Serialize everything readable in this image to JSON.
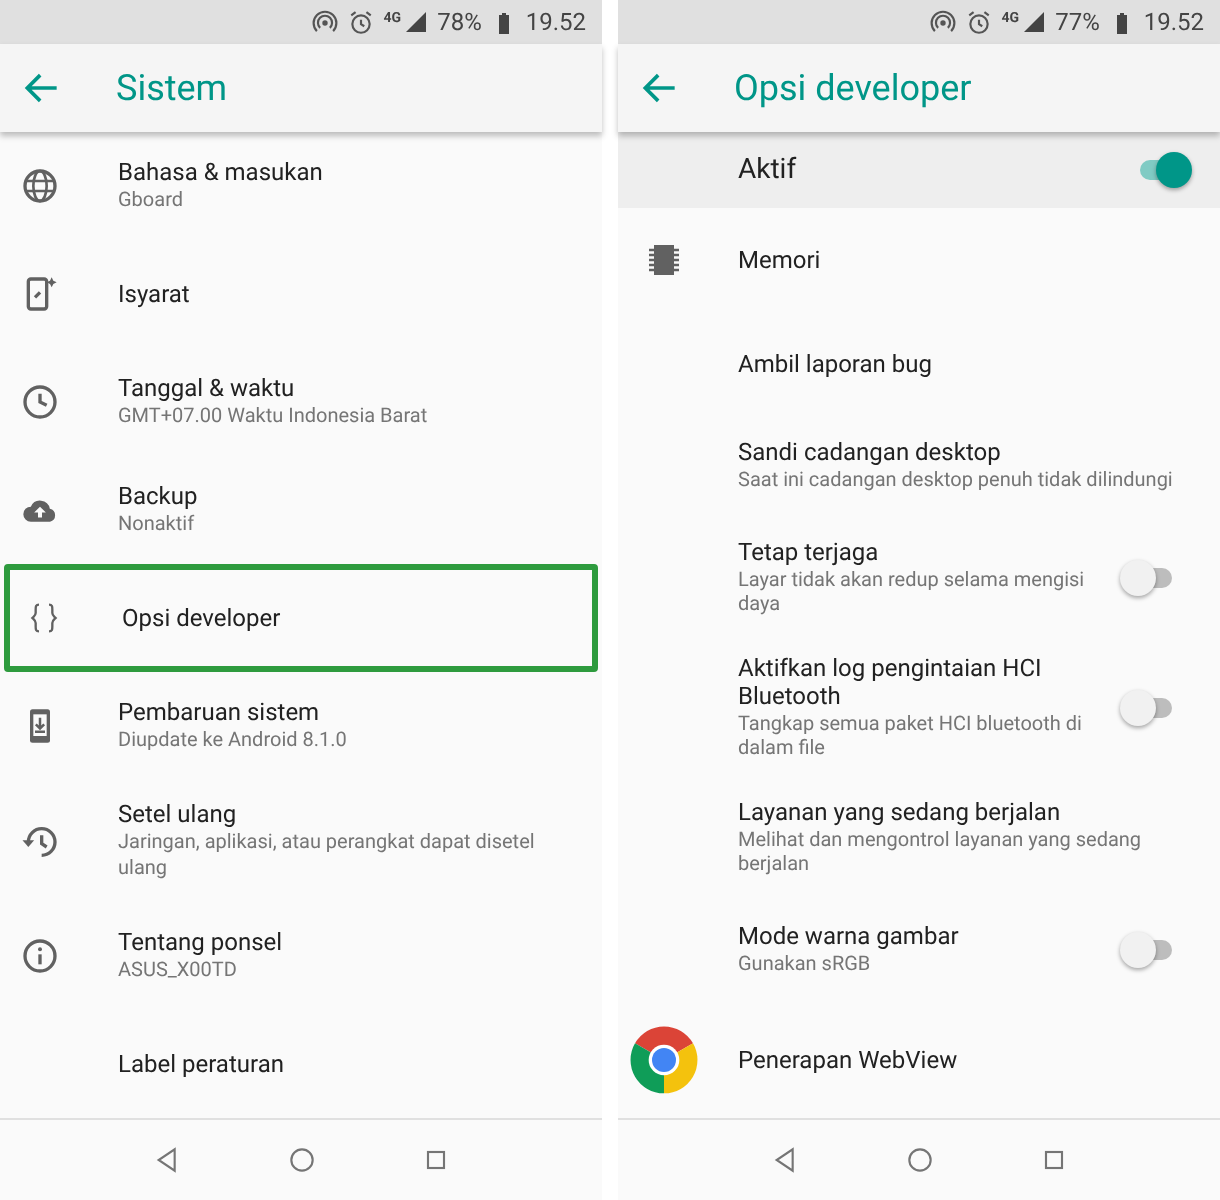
{
  "panels": [
    {
      "status_bar": {
        "network": "4G",
        "battery": "78%",
        "time": "19.52"
      },
      "title": "Sistem",
      "items": [
        {
          "title": "Bahasa & masukan",
          "subtitle": "Gboard",
          "highlighted": false
        },
        {
          "title": "Isyarat",
          "highlighted": false
        },
        {
          "title": "Tanggal & waktu",
          "subtitle": "GMT+07.00 Waktu Indonesia Barat",
          "highlighted": false
        },
        {
          "title": "Backup",
          "subtitle": "Nonaktif",
          "highlighted": false
        },
        {
          "title": "Opsi developer",
          "highlighted": true
        },
        {
          "title": "Pembaruan sistem",
          "subtitle": "Diupdate ke Android 8.1.0",
          "highlighted": false
        },
        {
          "title": "Setel ulang",
          "subtitle": "Jaringan, aplikasi, atau perangkat dapat disetel ulang",
          "highlighted": false
        },
        {
          "title": "Tentang ponsel",
          "subtitle": "ASUS_X00TD",
          "highlighted": false
        },
        {
          "title": "Label peraturan",
          "highlighted": false
        }
      ]
    },
    {
      "status_bar": {
        "network": "4G",
        "battery": "77%",
        "time": "19.52"
      },
      "title": "Opsi developer",
      "master": {
        "label": "Aktif",
        "on": true
      },
      "items": [
        {
          "kind": "plain",
          "title": "Memori"
        },
        {
          "kind": "plain",
          "title": "Ambil laporan bug"
        },
        {
          "kind": "plain",
          "title": "Sandi cadangan desktop",
          "subtitle": "Saat ini cadangan desktop penuh tidak dilindungi"
        },
        {
          "kind": "toggle",
          "title": "Tetap terjaga",
          "subtitle": "Layar tidak akan redup selama mengisi daya",
          "on": false
        },
        {
          "kind": "toggle",
          "title": "Aktifkan log pengintaian HCI Bluetooth",
          "subtitle": "Tangkap semua paket HCI bluetooth di dalam file",
          "on": false
        },
        {
          "kind": "plain",
          "title": "Layanan yang sedang berjalan",
          "subtitle": "Melihat dan mengontrol layanan yang sedang berjalan"
        },
        {
          "kind": "toggle",
          "title": "Mode warna gambar",
          "subtitle": "Gunakan sRGB",
          "on": false
        },
        {
          "kind": "plain",
          "title": "Penerapan WebView"
        }
      ]
    }
  ]
}
